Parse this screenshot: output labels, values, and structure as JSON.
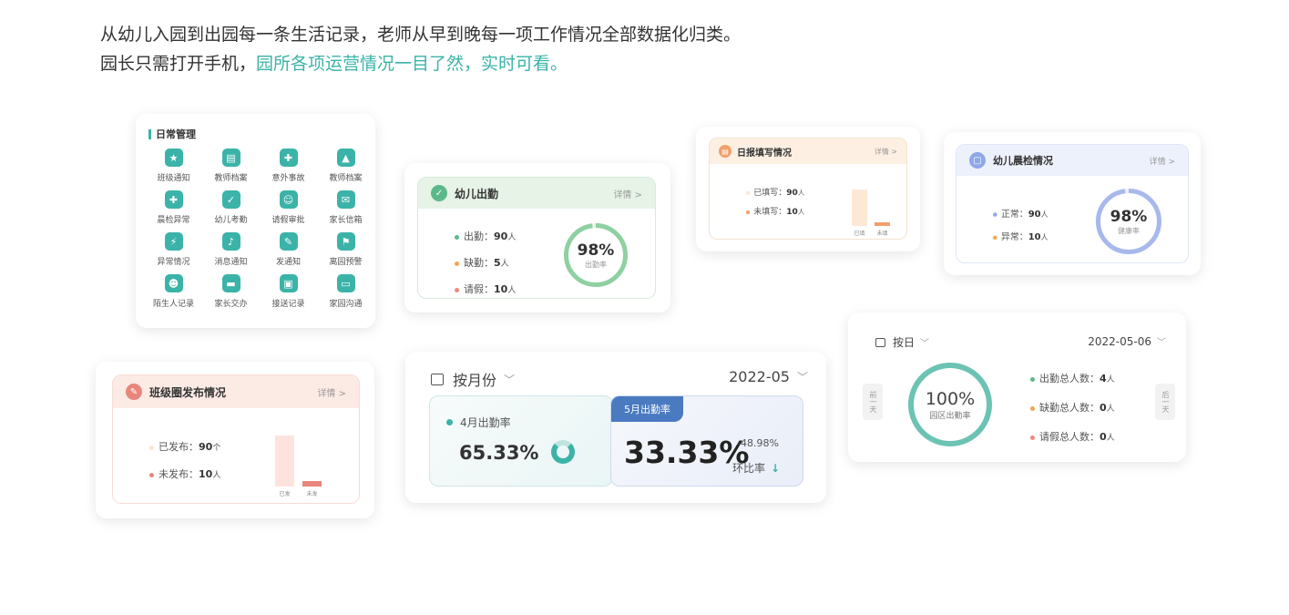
{
  "intro": {
    "line1": "从幼儿入园到出园每一条生活记录，老师从早到晚每一项工作情况全部数据化归类。",
    "line2_prefix": "园长只需打开手机，",
    "line2_highlight": "园所各项运营情况一目了然，实时可看。"
  },
  "daily": {
    "title": "日常管理",
    "items": [
      {
        "label": "班级通知",
        "icon": "notice-icon",
        "color": "#3bb3a8",
        "glyph": "★"
      },
      {
        "label": "教师档案",
        "icon": "teacher-file-icon",
        "color": "#3bb3a8",
        "glyph": "▤"
      },
      {
        "label": "意外事故",
        "icon": "accident-icon",
        "color": "#3bb3a8",
        "glyph": "✚"
      },
      {
        "label": "教师档案",
        "icon": "bell-cover-icon",
        "color": "#3bb3a8",
        "glyph": "▲"
      },
      {
        "label": "晨检异常",
        "icon": "medical-box-icon",
        "color": "#3bb3a8",
        "glyph": "✚"
      },
      {
        "label": "幼儿考勤",
        "icon": "attendance-icon",
        "color": "#3bb3a8",
        "glyph": "✓"
      },
      {
        "label": "请假审批",
        "icon": "leave-approval-icon",
        "color": "#3bb3a8",
        "glyph": "☺"
      },
      {
        "label": "家长信箱",
        "icon": "mail-icon",
        "color": "#3bb3a8",
        "glyph": "✉"
      },
      {
        "label": "异常情况",
        "icon": "alert-icon",
        "color": "#3bb3a8",
        "glyph": "⚡"
      },
      {
        "label": "消息通知",
        "icon": "bell-icon",
        "color": "#3bb3a8",
        "glyph": "♪"
      },
      {
        "label": "发通知",
        "icon": "send-notice-icon",
        "color": "#3bb3a8",
        "glyph": "✎"
      },
      {
        "label": "离园预警",
        "icon": "leave-warning-icon",
        "color": "#3bb3a8",
        "glyph": "⚑"
      },
      {
        "label": "陌生人记录",
        "icon": "stranger-icon",
        "color": "#3bb3a8",
        "glyph": "☻"
      },
      {
        "label": "家长交办",
        "icon": "parent-task-icon",
        "color": "#3bb3a8",
        "glyph": "▬"
      },
      {
        "label": "接送记录",
        "icon": "pickup-icon",
        "color": "#3bb3a8",
        "glyph": "▣"
      },
      {
        "label": "家园沟通",
        "icon": "chat-icon",
        "color": "#3bb3a8",
        "glyph": "▭"
      }
    ]
  },
  "attendance": {
    "title": "幼儿出勤",
    "more": "详情 >",
    "stats": [
      {
        "label": "出勤：",
        "value": "90",
        "unit": "人",
        "color": "#5cb88a"
      },
      {
        "label": "缺勤：",
        "value": "5",
        "unit": "人",
        "color": "#f0a850"
      },
      {
        "label": "请假：",
        "value": "10",
        "unit": "人",
        "color": "#ef8a7a"
      }
    ],
    "pct": "98%",
    "pct_value": 0.98,
    "sub": "出勤率"
  },
  "report": {
    "title": "日报填写情况",
    "more": "详情 >",
    "stats": [
      {
        "label": "已填写：",
        "value": "90",
        "unit": "人",
        "color": "#fbe3cc"
      },
      {
        "label": "未填写：",
        "value": "10",
        "unit": "人",
        "color": "#f0a06a"
      }
    ],
    "bars": [
      {
        "label": "已填",
        "value": 90,
        "color": "#fde8d6"
      },
      {
        "label": "未填",
        "value": 10,
        "color": "#f0a06a"
      }
    ]
  },
  "morning": {
    "title": "幼儿晨检情况",
    "more": "详情 >",
    "stats": [
      {
        "label": "正常：",
        "value": "90",
        "unit": "人",
        "color": "#8fa8e8"
      },
      {
        "label": "异常：",
        "value": "10",
        "unit": "人",
        "color": "#f0a850"
      }
    ],
    "pct": "98%",
    "pct_value": 0.98,
    "sub": "健康率"
  },
  "circle": {
    "title": "班级圈发布情况",
    "more": "详情 >",
    "stats": [
      {
        "label": "已发布：",
        "value": "90",
        "unit": "个",
        "color": "#fbe3cc"
      },
      {
        "label": "未发布：",
        "value": "10",
        "unit": "人",
        "color": "#e8867c"
      }
    ],
    "bars": [
      {
        "label": "已发",
        "value": 90,
        "color": "#fde3dc"
      },
      {
        "label": "未发",
        "value": 10,
        "color": "#e8867c"
      }
    ]
  },
  "monthly": {
    "selector": "按月份",
    "date": "2022-05",
    "left": {
      "label": "4月出勤率",
      "value": "65.33%"
    },
    "right": {
      "tag": "5月出勤率",
      "value": "33.33%",
      "delta": "-48.98%",
      "delta_label": "环比率"
    }
  },
  "day": {
    "selector": "按日",
    "date": "2022-05-06",
    "prev": "前一天",
    "next": "后一天",
    "pct": "100%",
    "pct_value": 1.0,
    "sub": "园区出勤率",
    "stats": [
      {
        "label": "出勤总人数：",
        "value": "4",
        "unit": "人",
        "color": "#5cb88a"
      },
      {
        "label": "缺勤总人数：",
        "value": "0",
        "unit": "人",
        "color": "#f0a850"
      },
      {
        "label": "请假总人数：",
        "value": "0",
        "unit": "人",
        "color": "#ef8a7a"
      }
    ]
  }
}
